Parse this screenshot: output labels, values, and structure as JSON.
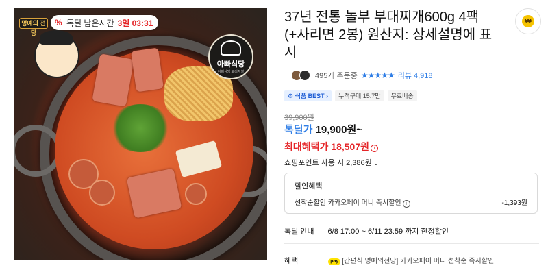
{
  "image": {
    "famous_badge": "명예의 전당",
    "timer_label": "톡딜 남은시간",
    "timer_value": "3일 03:31",
    "store_logo_text": "아빠식당",
    "store_logo_sub": "아빠식당 오리지널"
  },
  "product": {
    "title": "37년 전통 놀부 부대찌개600g 4팩(+사리면 2봉) 원산지: 상세설명에 표시",
    "order_count": "495개 주문중",
    "stars": "★★★★★",
    "review_link": "리뷰 4,918",
    "tags": [
      "식품 BEST",
      "누적구매 15.7만",
      "무료배송"
    ],
    "original_price": "39,900원",
    "deal_label": "톡딜가",
    "deal_value": "19,900원~",
    "max_benefit": "최대혜택가 18,507원",
    "points": "쇼핑포인트 사용 시 2,386원"
  },
  "benefit_box": {
    "title": "할인혜택",
    "line_label": "선착순할인",
    "line_text": "카카오페이 머니 즉시할인",
    "amount": "-1,393원"
  },
  "deal_period": {
    "label": "톡딜 안내",
    "text": "6/8 17:00 ~ 6/11 23:59 까지 한정할인"
  },
  "pay_benefit": {
    "label": "혜택",
    "badge": "pay",
    "text": "[간편식 명예의전당] 카카오페이 머니 선착순 즉시할인"
  },
  "colors": {
    "accent_blue": "#2f7ee6",
    "accent_red": "#e52528",
    "coin_yellow": "#f6c300"
  },
  "icons": {
    "coin": "won-coin-icon",
    "timer": "percent-icon",
    "info": "info-icon",
    "chevron": "chevron-down-icon"
  }
}
